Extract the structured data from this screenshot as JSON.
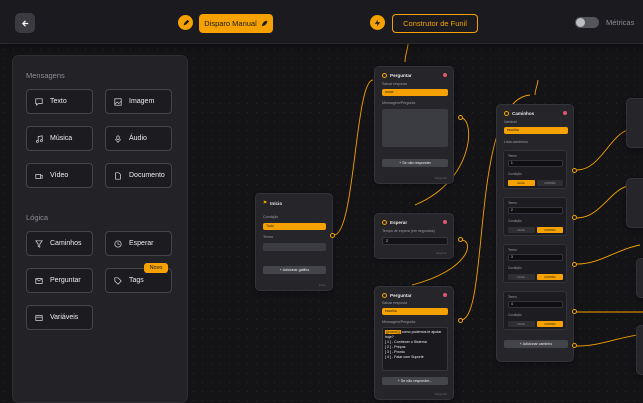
{
  "topbar": {
    "disparo_label": "Disparo Manual",
    "construtor_label": "Construtor de Funil",
    "metricas_label": "Métricas"
  },
  "sidebar": {
    "mensagens_title": "Mensagens",
    "mensagens": [
      {
        "label": "Texto",
        "icon": "message-icon"
      },
      {
        "label": "Imagem",
        "icon": "image-icon"
      },
      {
        "label": "Música",
        "icon": "music-icon"
      },
      {
        "label": "Áudio",
        "icon": "microphone-icon"
      },
      {
        "label": "Vídeo",
        "icon": "video-icon"
      },
      {
        "label": "Documento",
        "icon": "document-icon"
      }
    ],
    "logica_title": "Lógica",
    "logica": [
      {
        "label": "Caminhos",
        "icon": "filter-icon"
      },
      {
        "label": "Esperar",
        "icon": "clock-icon"
      },
      {
        "label": "Perguntar",
        "icon": "question-icon"
      },
      {
        "label": "Tags",
        "icon": "tag-icon"
      },
      {
        "label": "Variáveis",
        "icon": "variables-icon"
      }
    ],
    "novo_badge": "Novo"
  },
  "nodes": {
    "inicio": {
      "title": "Início",
      "condicao_label": "Condição",
      "condicao_value": "Tudo",
      "termo_label": "Termo",
      "add_label": "+ Adicionar gatilho",
      "footer": "Início"
    },
    "perguntar1": {
      "title": "Perguntar",
      "salvar_label": "Salvar resposta",
      "salvar_value": "nome",
      "mensagem_label": "Mensagem/Pergunta",
      "nao_resp_label": "+ Se não responder",
      "footer": "Pergunta"
    },
    "esperar": {
      "title": "Esperar",
      "tempo_label": "Tempo de espera (em segundos)",
      "tempo_value": "2",
      "footer": "Esperar"
    },
    "perguntar2": {
      "title": "Perguntar",
      "salvar_label": "Salvar resposta",
      "salvar_value": "escolha",
      "mensagem_label": "Mensagem/Pergunta",
      "highlight": "{{nome}}",
      "question_text": "como podemos te ajudar hoje?",
      "options": [
        "[ 1 ] - Conhecer o Sistema",
        "[ 2 ] - Preços",
        "[ 3 ] - Pronto",
        "[ 4 ] - Falar com Suporte"
      ],
      "nao_resp_label": "+ Se não responder...",
      "footer": "Pergunta"
    },
    "caminhos": {
      "title": "Caminhos",
      "variavel_label": "Variável",
      "variavel_value": "escolha",
      "lista_label": "Lista caminhos",
      "termo_label": "Termo",
      "condicao_label": "Condição",
      "btn_a": "IGUAL",
      "btn_b": "CONTÉM",
      "paths": [
        "1",
        "2",
        "3",
        "4"
      ],
      "add_label": "+ Adicionar caminho"
    }
  }
}
